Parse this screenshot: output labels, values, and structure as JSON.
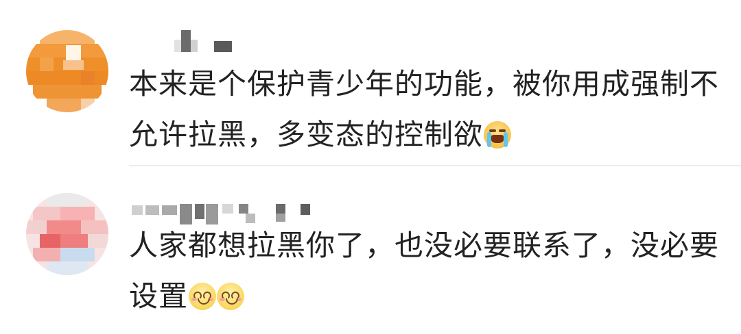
{
  "comments": [
    {
      "avatar": "pixelated-orange-avatar",
      "username": "",
      "text": "本来是个保护青少年的功能，被你用成强制不允许拉黑，多变态的控制欲",
      "emojis": [
        "crying-face-emoji"
      ]
    },
    {
      "avatar": "pixelated-pink-avatar",
      "username": "",
      "text": "人家都想拉黑你了，也没必要联系了，没必要设置",
      "emojis": [
        "smiling-face-emoji",
        "smiling-face-emoji"
      ]
    }
  ],
  "colors": {
    "text": "#222222",
    "divider": "#ececec",
    "avatar_1": "#f0902a",
    "avatar_2": "#f4a0a0"
  }
}
